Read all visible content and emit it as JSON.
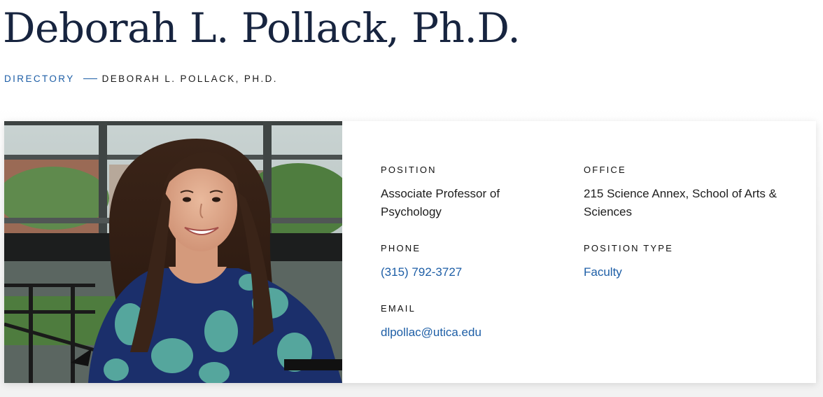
{
  "page": {
    "title": "Deborah L. Pollack, Ph.D."
  },
  "breadcrumb": {
    "directory": "DIRECTORY",
    "current": "DEBORAH L. POLLACK, PH.D."
  },
  "profile": {
    "photo_icon": "portrait-photo",
    "position": {
      "label": "POSITION",
      "value": "Associate Professor of Psychology"
    },
    "office": {
      "label": "OFFICE",
      "value": "215 Science Annex, School of Arts & Sciences"
    },
    "phone": {
      "label": "PHONE",
      "value": "(315) 792-3727"
    },
    "position_type": {
      "label": "POSITION TYPE",
      "value": "Faculty"
    },
    "email": {
      "label": "EMAIL",
      "value": "dlpollac@utica.edu"
    }
  },
  "colors": {
    "title": "#17243f",
    "link": "#1d5ea6",
    "text": "#1d1d1d"
  }
}
